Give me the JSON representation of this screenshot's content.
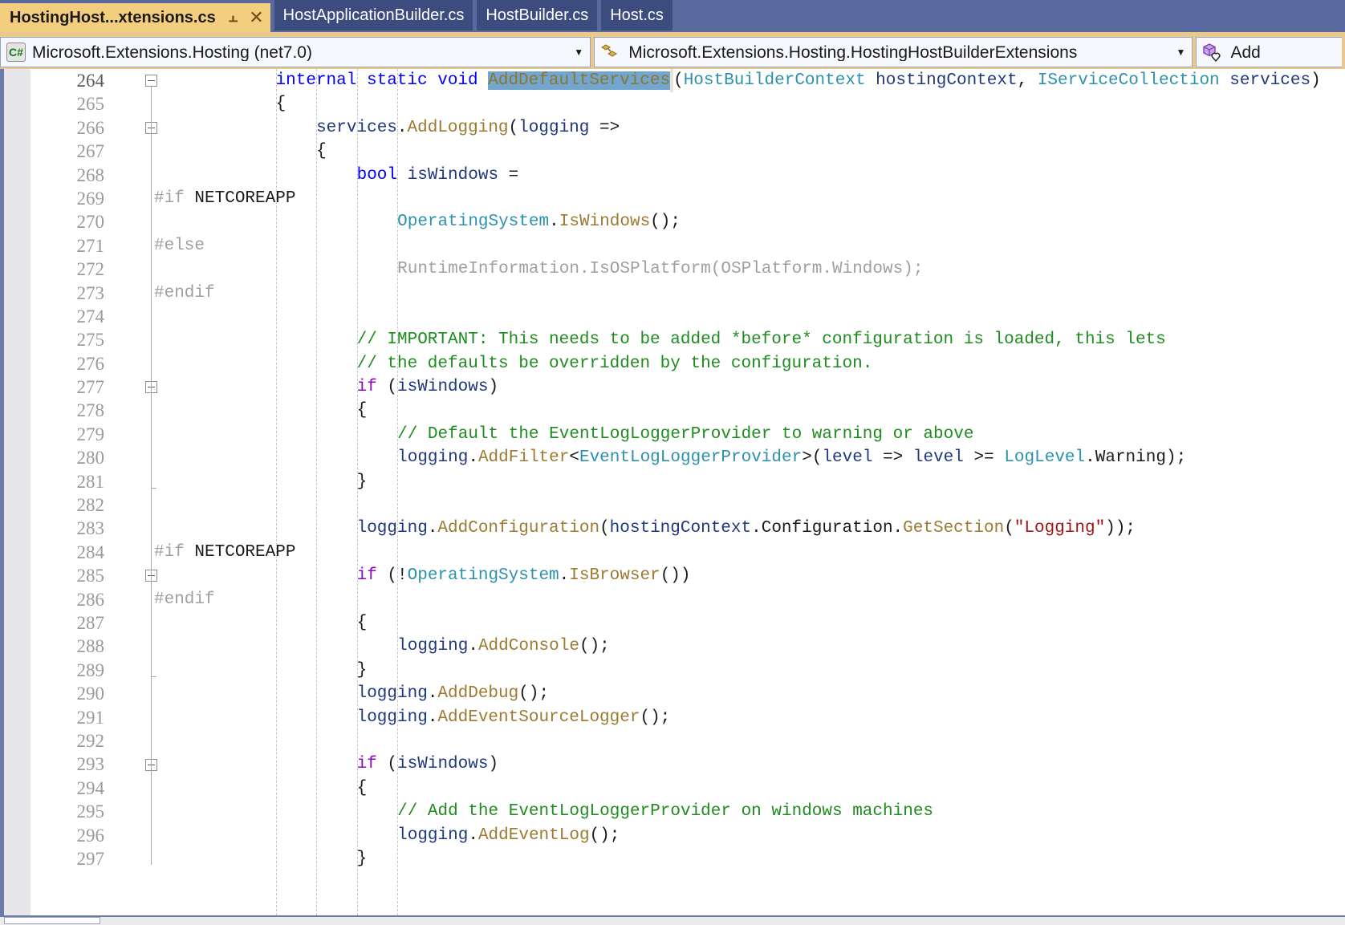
{
  "window": {
    "app": "Visual Studio",
    "accent_active_tab": "#F3CE7E",
    "accent_tabbar": "#5A6A9E"
  },
  "tabbar": {
    "tabs": [
      {
        "label": "HostingHost...xtensions.cs",
        "active": true,
        "pin_icon": "pin-icon",
        "close_icon": "close-icon"
      },
      {
        "label": "HostApplicationBuilder.cs",
        "active": false
      },
      {
        "label": "HostBuilder.cs",
        "active": false
      },
      {
        "label": "Host.cs",
        "active": false
      }
    ]
  },
  "navbar": {
    "project": {
      "icon": "csharp-project-icon",
      "value": "Microsoft.Extensions.Hosting (net7.0)",
      "arrow": "▼"
    },
    "type": {
      "icon": "class-icon",
      "value": "Microsoft.Extensions.Hosting.HostingHostBuilderExtensions",
      "arrow": "▼"
    },
    "member": {
      "icon": "method-icon",
      "value": "Add",
      "arrow": "▼"
    }
  },
  "editor": {
    "file": "HostingHostBuilderExtensions.cs",
    "selection": "AddDefaultServices",
    "first_line": 264,
    "last_line": 297,
    "lines": [
      {
        "n": 264,
        "fold": "start",
        "tokens": [
          {
            "t": "internal",
            "c": "kw"
          },
          {
            "t": " ",
            "c": "pln"
          },
          {
            "t": "static",
            "c": "kw"
          },
          {
            "t": " ",
            "c": "pln"
          },
          {
            "t": "void",
            "c": "kw"
          },
          {
            "t": " ",
            "c": "pln"
          },
          {
            "t": "AddDefaultServices",
            "c": "sel"
          },
          {
            "t": "(",
            "c": "pln"
          },
          {
            "t": "HostBuilderContext",
            "c": "type"
          },
          {
            "t": " ",
            "c": "pln"
          },
          {
            "t": "hostingContext",
            "c": "loc"
          },
          {
            "t": ", ",
            "c": "pln"
          },
          {
            "t": "IServiceCollection",
            "c": "type"
          },
          {
            "t": " ",
            "c": "pln"
          },
          {
            "t": "services",
            "c": "loc"
          },
          {
            "t": ")",
            "c": "pln"
          }
        ],
        "indent": 12
      },
      {
        "n": 265,
        "tokens": [
          {
            "t": "{",
            "c": "pln"
          }
        ],
        "indent": 12
      },
      {
        "n": 266,
        "fold": "start",
        "tokens": [
          {
            "t": "services",
            "c": "loc"
          },
          {
            "t": ".",
            "c": "pln"
          },
          {
            "t": "AddLogging",
            "c": "mth"
          },
          {
            "t": "(",
            "c": "pln"
          },
          {
            "t": "logging",
            "c": "loc"
          },
          {
            "t": " =>",
            "c": "pln"
          }
        ],
        "indent": 16
      },
      {
        "n": 267,
        "tokens": [
          {
            "t": "{",
            "c": "pln"
          }
        ],
        "indent": 16
      },
      {
        "n": 268,
        "tokens": [
          {
            "t": "bool",
            "c": "kw"
          },
          {
            "t": " ",
            "c": "pln"
          },
          {
            "t": "isWindows",
            "c": "loc"
          },
          {
            "t": " =",
            "c": "pln"
          }
        ],
        "indent": 20
      },
      {
        "n": 269,
        "pp": true,
        "tokens": [
          {
            "t": "#if",
            "c": "gray"
          },
          {
            "t": " ",
            "c": "pln"
          },
          {
            "t": "NETCOREAPP",
            "c": "ppdef"
          }
        ],
        "indent": 0
      },
      {
        "n": 270,
        "tokens": [
          {
            "t": "OperatingSystem",
            "c": "type"
          },
          {
            "t": ".",
            "c": "pln"
          },
          {
            "t": "IsWindows",
            "c": "mth"
          },
          {
            "t": "();",
            "c": "pln"
          }
        ],
        "indent": 24
      },
      {
        "n": 271,
        "pp": true,
        "tokens": [
          {
            "t": "#else",
            "c": "gray"
          }
        ],
        "indent": 0
      },
      {
        "n": 272,
        "inactive": true,
        "tokens": [
          {
            "t": "RuntimeInformation.IsOSPlatform(OSPlatform.Windows);",
            "c": "gray"
          }
        ],
        "indent": 24
      },
      {
        "n": 273,
        "pp": true,
        "tokens": [
          {
            "t": "#endif",
            "c": "gray"
          }
        ],
        "indent": 0
      },
      {
        "n": 274,
        "tokens": [],
        "indent": 0
      },
      {
        "n": 275,
        "tokens": [
          {
            "t": "// IMPORTANT: This needs to be added *before* configuration is loaded, this lets",
            "c": "cmt"
          }
        ],
        "indent": 20
      },
      {
        "n": 276,
        "tokens": [
          {
            "t": "// the defaults be overridden by the configuration.",
            "c": "cmt"
          }
        ],
        "indent": 20
      },
      {
        "n": 277,
        "fold": "start",
        "tokens": [
          {
            "t": "if",
            "c": "ctrl"
          },
          {
            "t": " (",
            "c": "pln"
          },
          {
            "t": "isWindows",
            "c": "loc"
          },
          {
            "t": ")",
            "c": "pln"
          }
        ],
        "indent": 20
      },
      {
        "n": 278,
        "tokens": [
          {
            "t": "{",
            "c": "pln"
          }
        ],
        "indent": 20
      },
      {
        "n": 279,
        "tokens": [
          {
            "t": "// Default the EventLogLoggerProvider to warning or above",
            "c": "cmt"
          }
        ],
        "indent": 24
      },
      {
        "n": 280,
        "tokens": [
          {
            "t": "logging",
            "c": "loc"
          },
          {
            "t": ".",
            "c": "pln"
          },
          {
            "t": "AddFilter",
            "c": "mth"
          },
          {
            "t": "<",
            "c": "pln"
          },
          {
            "t": "EventLogLoggerProvider",
            "c": "type"
          },
          {
            "t": ">(",
            "c": "pln"
          },
          {
            "t": "level",
            "c": "loc"
          },
          {
            "t": " => ",
            "c": "pln"
          },
          {
            "t": "level",
            "c": "loc"
          },
          {
            "t": " >= ",
            "c": "pln"
          },
          {
            "t": "LogLevel",
            "c": "type"
          },
          {
            "t": ".",
            "c": "pln"
          },
          {
            "t": "Warning",
            "c": "pln"
          },
          {
            "t": ");",
            "c": "pln"
          }
        ],
        "indent": 24
      },
      {
        "n": 281,
        "fold": "end",
        "tokens": [
          {
            "t": "}",
            "c": "pln"
          }
        ],
        "indent": 20
      },
      {
        "n": 282,
        "tokens": [],
        "indent": 0
      },
      {
        "n": 283,
        "tokens": [
          {
            "t": "logging",
            "c": "loc"
          },
          {
            "t": ".",
            "c": "pln"
          },
          {
            "t": "AddConfiguration",
            "c": "mth"
          },
          {
            "t": "(",
            "c": "pln"
          },
          {
            "t": "hostingContext",
            "c": "loc"
          },
          {
            "t": ".",
            "c": "pln"
          },
          {
            "t": "Configuration",
            "c": "pln"
          },
          {
            "t": ".",
            "c": "pln"
          },
          {
            "t": "GetSection",
            "c": "mth"
          },
          {
            "t": "(",
            "c": "pln"
          },
          {
            "t": "\"Logging\"",
            "c": "str"
          },
          {
            "t": "));",
            "c": "pln"
          }
        ],
        "indent": 20
      },
      {
        "n": 284,
        "pp": true,
        "tokens": [
          {
            "t": "#if",
            "c": "gray"
          },
          {
            "t": " ",
            "c": "pln"
          },
          {
            "t": "NETCOREAPP",
            "c": "ppdef"
          }
        ],
        "indent": 0
      },
      {
        "n": 285,
        "fold": "start",
        "tokens": [
          {
            "t": "if",
            "c": "ctrl"
          },
          {
            "t": " (!",
            "c": "pln"
          },
          {
            "t": "OperatingSystem",
            "c": "type"
          },
          {
            "t": ".",
            "c": "pln"
          },
          {
            "t": "IsBrowser",
            "c": "mth"
          },
          {
            "t": "())",
            "c": "pln"
          }
        ],
        "indent": 20
      },
      {
        "n": 286,
        "pp": true,
        "tokens": [
          {
            "t": "#endif",
            "c": "gray"
          }
        ],
        "indent": 0
      },
      {
        "n": 287,
        "tokens": [
          {
            "t": "{",
            "c": "pln"
          }
        ],
        "indent": 20
      },
      {
        "n": 288,
        "tokens": [
          {
            "t": "logging",
            "c": "loc"
          },
          {
            "t": ".",
            "c": "pln"
          },
          {
            "t": "AddConsole",
            "c": "mth"
          },
          {
            "t": "();",
            "c": "pln"
          }
        ],
        "indent": 24
      },
      {
        "n": 289,
        "fold": "end",
        "tokens": [
          {
            "t": "}",
            "c": "pln"
          }
        ],
        "indent": 20
      },
      {
        "n": 290,
        "tokens": [
          {
            "t": "logging",
            "c": "loc"
          },
          {
            "t": ".",
            "c": "pln"
          },
          {
            "t": "AddDebug",
            "c": "mth"
          },
          {
            "t": "();",
            "c": "pln"
          }
        ],
        "indent": 20
      },
      {
        "n": 291,
        "tokens": [
          {
            "t": "logging",
            "c": "loc"
          },
          {
            "t": ".",
            "c": "pln"
          },
          {
            "t": "AddEventSourceLogger",
            "c": "mth"
          },
          {
            "t": "();",
            "c": "pln"
          }
        ],
        "indent": 20
      },
      {
        "n": 292,
        "tokens": [],
        "indent": 0
      },
      {
        "n": 293,
        "fold": "start",
        "tokens": [
          {
            "t": "if",
            "c": "ctrl"
          },
          {
            "t": " (",
            "c": "pln"
          },
          {
            "t": "isWindows",
            "c": "loc"
          },
          {
            "t": ")",
            "c": "pln"
          }
        ],
        "indent": 20
      },
      {
        "n": 294,
        "tokens": [
          {
            "t": "{",
            "c": "pln"
          }
        ],
        "indent": 20
      },
      {
        "n": 295,
        "tokens": [
          {
            "t": "// Add the EventLogLoggerProvider on windows machines",
            "c": "cmt"
          }
        ],
        "indent": 24
      },
      {
        "n": 296,
        "tokens": [
          {
            "t": "logging",
            "c": "loc"
          },
          {
            "t": ".",
            "c": "pln"
          },
          {
            "t": "AddEventLog",
            "c": "mth"
          },
          {
            "t": "();",
            "c": "pln"
          }
        ],
        "indent": 24
      },
      {
        "n": 297,
        "tokens": [
          {
            "t": "}",
            "c": "pln"
          }
        ],
        "indent": 20
      }
    ]
  },
  "scrollbar": {
    "orientation": "horizontal",
    "name": "horizontal-scrollbar"
  }
}
